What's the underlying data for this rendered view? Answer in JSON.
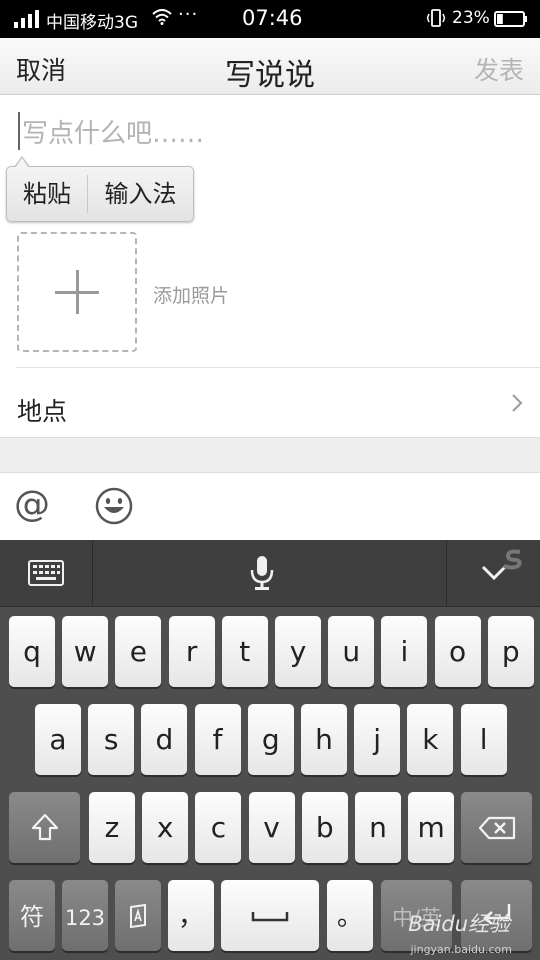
{
  "status_bar": {
    "carrier": "中国移动3G",
    "dots": "···",
    "time": "07:46",
    "battery": "23%",
    "battery_level": 0.23
  },
  "header": {
    "cancel": "取消",
    "title": "写说说",
    "publish": "发表"
  },
  "compose": {
    "placeholder": "写点什么吧……",
    "popup": {
      "paste": "粘贴",
      "input_method": "输入法"
    },
    "add_photo": "添加照片",
    "location": "地点"
  },
  "toolbar": {
    "at": "@"
  },
  "keyboard": {
    "row1": [
      "q",
      "w",
      "e",
      "r",
      "t",
      "y",
      "u",
      "i",
      "o",
      "p"
    ],
    "row2": [
      "a",
      "s",
      "d",
      "f",
      "g",
      "h",
      "j",
      "k",
      "l"
    ],
    "row3": [
      "z",
      "x",
      "c",
      "v",
      "b",
      "n",
      "m"
    ],
    "row4": {
      "symbols": "符",
      "numbers": "123",
      "comma": "，",
      "period": "。",
      "zh_en": "中/英"
    }
  },
  "watermark": {
    "logo": "Baidu经验",
    "url": "jingyan.baidu.com"
  },
  "colors": {
    "statusbar": "#000000",
    "keyboard_bg": "#4e4e4e",
    "publish_disabled": "#b5b5b5"
  }
}
